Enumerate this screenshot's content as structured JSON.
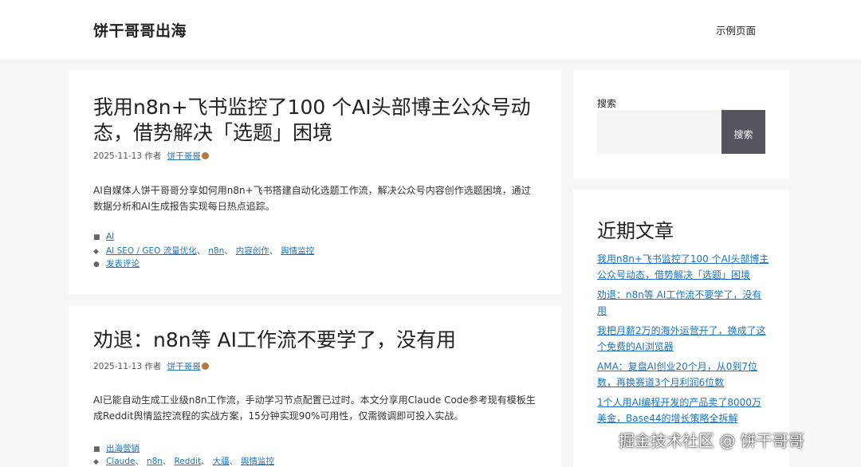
{
  "header": {
    "site_title": "饼干哥哥出海",
    "nav_item": "示例页面"
  },
  "posts": [
    {
      "title": "我用n8n+飞书监控了100 个AI头部博主公众号动态，借势解决「选题」困境",
      "date": "2025-11-13",
      "author_prefix": "作者",
      "author": "饼干哥哥",
      "excerpt": "AI自媒体人饼干哥哥分享如何用n8n+飞书搭建自动化选题工作流，解决公众号内容创作选题困境，通过数据分析和AI生成报告实现每日热点追踪。",
      "categories": [
        "AI"
      ],
      "tags": [
        "AI SEO / GEO 流量优化",
        "n8n",
        "内容创作",
        "舆情监控"
      ],
      "comment_link": "发表评论"
    },
    {
      "title": "劝退：n8n等 AI工作流不要学了，没有用",
      "date": "2025-11-13",
      "author_prefix": "作者",
      "author": "饼干哥哥",
      "excerpt": "AI已能自动生成工业级n8n工作流，手动学习节点配置已过时。本文分享用Claude Code参考现有模板生成Reddit舆情监控流程的实战方案，15分钟实现90%可用性，仅需微调即可投入实战。",
      "categories": [
        "出海营销"
      ],
      "tags": [
        "Claude",
        "n8n",
        "Reddit",
        "大疆",
        "舆情监控"
      ]
    }
  ],
  "sidebar": {
    "search": {
      "label": "搜索",
      "value": "",
      "button": "搜索"
    },
    "recent": {
      "heading": "近期文章",
      "items": [
        "我用n8n+飞书监控了100 个AI头部博主公众号动态，借势解决「选题」困境",
        "劝退：n8n等 AI工作流不要学了，没有用",
        "我把月薪2万的海外运营开了，换成了这个免费的AI浏览器",
        "AMA：复盘AI创业20个月，从0到7位数，再换赛道3个月利润6位数",
        "1个人用AI编程开发的产品卖了8000万美金，Base44的增长策略全拆解"
      ]
    }
  },
  "watermark": "掘金技术社区 @ 饼干哥哥",
  "icons": {
    "category": "folder-icon",
    "tag": "tag-icon",
    "comment": "comment-icon",
    "author_emoji": "cookie-icon"
  }
}
